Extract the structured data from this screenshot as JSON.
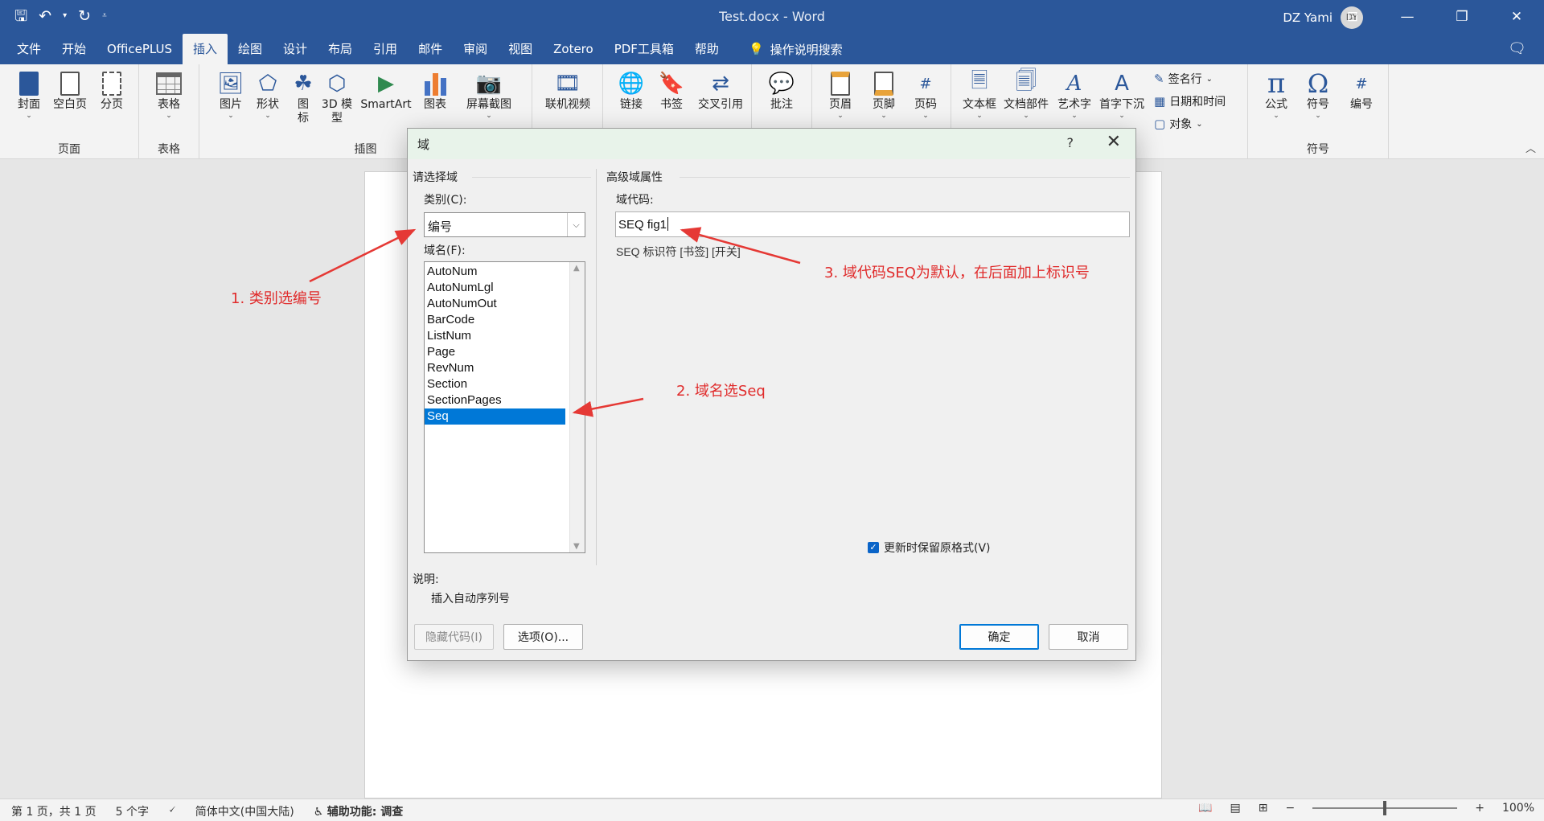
{
  "titlebar": {
    "doc_title": "Test.docx  -  Word",
    "user_name": "DZ Yami",
    "avatar_initials": "DY"
  },
  "menu": {
    "tabs": [
      "文件",
      "开始",
      "OfficePLUS",
      "插入",
      "绘图",
      "设计",
      "布局",
      "引用",
      "邮件",
      "审阅",
      "视图",
      "Zotero",
      "PDF工具箱",
      "帮助"
    ],
    "active_tab": "插入",
    "tell_me": "操作说明搜索"
  },
  "ribbon": {
    "groups": {
      "pages": {
        "label": "页面",
        "buttons": [
          "封面",
          "空白页",
          "分页"
        ]
      },
      "tables": {
        "label": "表格",
        "buttons": [
          "表格"
        ]
      },
      "illustrations": {
        "label": "插图",
        "buttons": [
          "图片",
          "形状",
          "图标",
          "3D 模型",
          "SmartArt",
          "图表",
          "屏幕截图"
        ]
      },
      "media": {
        "buttons": [
          "联机视频"
        ]
      },
      "links": {
        "buttons": [
          "链接",
          "书签",
          "交叉引用"
        ]
      },
      "comments": {
        "buttons": [
          "批注"
        ]
      },
      "header_footer": {
        "buttons": [
          "页眉",
          "页脚",
          "页码"
        ]
      },
      "text": {
        "buttons": [
          "文本框",
          "文档部件",
          "艺术字",
          "首字下沉"
        ],
        "small_buttons": [
          "签名行",
          "日期和时间",
          "对象"
        ]
      },
      "symbols": {
        "label": "符号",
        "buttons": [
          "公式",
          "符号",
          "编号"
        ]
      }
    }
  },
  "statusbar": {
    "page": "第 1 页，共 1 页",
    "words": "5 个字",
    "language": "简体中文(中国大陆)",
    "accessibility": "辅助功能: 调查",
    "zoom": "100%"
  },
  "dialog": {
    "title": "域",
    "help": "?",
    "left_section_title": "请选择域",
    "category_label": "类别(C):",
    "category_value": "编号",
    "fieldname_label": "域名(F):",
    "fieldnames": [
      "AutoNum",
      "AutoNumLgl",
      "AutoNumOut",
      "BarCode",
      "ListNum",
      "Page",
      "RevNum",
      "Section",
      "SectionPages",
      "Seq"
    ],
    "selected_fieldname": "Seq",
    "right_section_title": "高级域属性",
    "fieldcode_label": "域代码:",
    "fieldcode_value": "SEQ fig1",
    "syntax_hint": "SEQ 标识符 [书签] [开关]",
    "description_label": "说明:",
    "description_text": "插入自动序列号",
    "preserve_format_label": "更新时保留原格式(V)",
    "preserve_format_checked": true,
    "hide_codes_button": "隐藏代码(I)",
    "options_button": "选项(O)...",
    "ok_button": "确定",
    "cancel_button": "取消"
  },
  "annotations": {
    "step1": "1. 类别选编号",
    "step2": "2. 域名选Seq",
    "step3": "3. 域代码SEQ为默认，在后面加上标识号",
    "color": "#e02b2b"
  }
}
